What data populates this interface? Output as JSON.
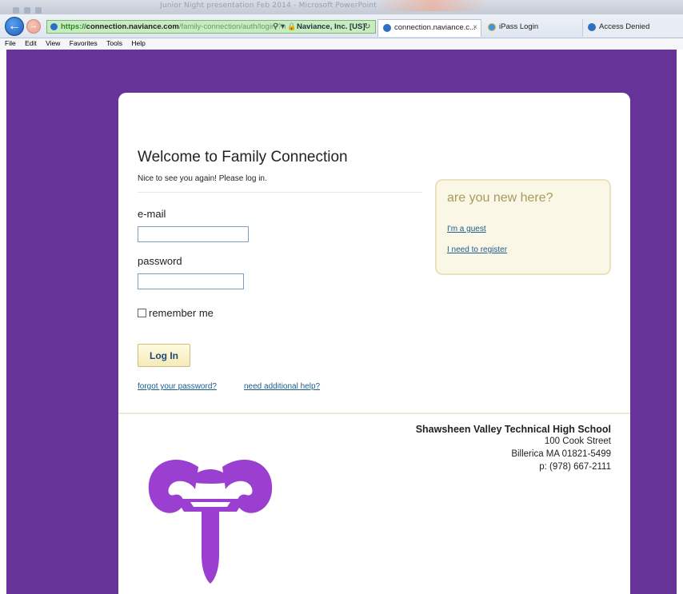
{
  "browser": {
    "window_title": "Junior Night presentation Feb 2014 - Microsoft PowerPoint",
    "address": {
      "scheme": "https://",
      "host": "connection.naviance.com",
      "path": "/family-connection/auth/login/?h",
      "search_glyph": "⚲ ▾",
      "certificate": "Naviance, Inc. [US]"
    },
    "tabs": [
      {
        "label": "connection.naviance.c...",
        "active": true,
        "close": "×"
      },
      {
        "label": "iPass Login"
      },
      {
        "label": "Access Denied"
      }
    ],
    "menu": [
      {
        "label": "File"
      },
      {
        "label": "Edit"
      },
      {
        "label": "View"
      },
      {
        "label": "Favorites"
      },
      {
        "label": "Tools"
      },
      {
        "label": "Help"
      }
    ]
  },
  "colors": {
    "page_background": "#663399",
    "accent_link": "#1a5c8c",
    "login_button_bg": "#f5eab8",
    "logo": "#9b3fd1"
  },
  "login": {
    "title": "Welcome to Family Connection",
    "subtitle": "Nice to see you again! Please log in.",
    "email_label": "e-mail",
    "email_value": "",
    "password_label": "password",
    "password_value": "",
    "remember_label": "remember me",
    "remember_checked": false,
    "login_button": "Log In",
    "forgot_link": "forgot your password?",
    "help_link": "need additional help?"
  },
  "new_here": {
    "title": "are you new here?",
    "guest_link": "I'm a guest",
    "register_link": "I need to register"
  },
  "school": {
    "name": "Shawsheen Valley Technical High School",
    "street": "100 Cook Street",
    "city": "Billerica MA 01821-5499",
    "phone": "p: (978) 667-2111"
  },
  "icons": {
    "back": "back-arrow-icon",
    "forward": "forward-arrow-icon",
    "lock": "lock-icon",
    "refresh": "refresh-icon",
    "logo": "ram-logo-icon"
  }
}
